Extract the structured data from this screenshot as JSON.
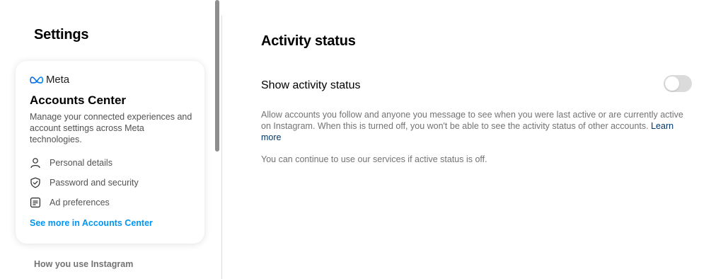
{
  "sidebar": {
    "title": "Settings",
    "accounts_center": {
      "logo_text": "Meta",
      "title": "Accounts Center",
      "description": "Manage your connected experiences and account settings across Meta technologies.",
      "items": [
        {
          "label": "Personal details",
          "icon": "person-icon"
        },
        {
          "label": "Password and security",
          "icon": "shield-check-icon"
        },
        {
          "label": "Ad preferences",
          "icon": "ad-preferences-icon"
        }
      ],
      "see_more": "See more in Accounts Center"
    },
    "section_heading": "How you use Instagram"
  },
  "main": {
    "title": "Activity status",
    "setting_label": "Show activity status",
    "toggle_on": false,
    "description": "Allow accounts you follow and anyone you message to see when you were last active or are currently active on Instagram. When this is turned off, you won't be able to see the activity status of other accounts.",
    "learn_more": "Learn more",
    "note": "You can continue to use our services if active status is off."
  },
  "colors": {
    "link_blue": "#0095f6",
    "learn_more_blue": "#00376b",
    "toggle_off": "#dbdbdb",
    "secondary_text": "#737373"
  }
}
